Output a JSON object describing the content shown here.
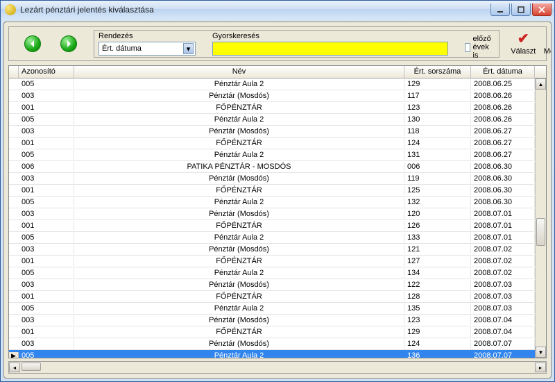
{
  "window": {
    "title": "Lezárt pénztári jelentés kiválasztása"
  },
  "toolbar": {
    "sort_label": "Rendezés",
    "sort_value": "Ért. dátuma",
    "search_label": "Gyorskeresés",
    "search_value": "",
    "prev_years_label": "előző évek is",
    "choose_label": "Választ",
    "cancel_label": "Mégse"
  },
  "columns": {
    "id": "Azonosító",
    "name": "Név",
    "sorszam": "Ért. sorszáma",
    "date": "Ért. dátuma"
  },
  "rows": [
    {
      "id": "005",
      "name": "Pénztár Aula 2",
      "sor": "129",
      "date": "2008.06.25"
    },
    {
      "id": "003",
      "name": "Pénztár (Mosdós)",
      "sor": "117",
      "date": "2008.06.26"
    },
    {
      "id": "001",
      "name": "FŐPÉNZTÁR",
      "sor": "123",
      "date": "2008.06.26"
    },
    {
      "id": "005",
      "name": "Pénztár Aula 2",
      "sor": "130",
      "date": "2008.06.26"
    },
    {
      "id": "003",
      "name": "Pénztár (Mosdós)",
      "sor": "118",
      "date": "2008.06.27"
    },
    {
      "id": "001",
      "name": "FŐPÉNZTÁR",
      "sor": "124",
      "date": "2008.06.27"
    },
    {
      "id": "005",
      "name": "Pénztár Aula 2",
      "sor": "131",
      "date": "2008.06.27"
    },
    {
      "id": "006",
      "name": "PATIKA PÉNZTÁR - MOSDÓS",
      "sor": "006",
      "date": "2008.06.30"
    },
    {
      "id": "003",
      "name": "Pénztár (Mosdós)",
      "sor": "119",
      "date": "2008.06.30"
    },
    {
      "id": "001",
      "name": "FŐPÉNZTÁR",
      "sor": "125",
      "date": "2008.06.30"
    },
    {
      "id": "005",
      "name": "Pénztár Aula 2",
      "sor": "132",
      "date": "2008.06.30"
    },
    {
      "id": "003",
      "name": "Pénztár (Mosdós)",
      "sor": "120",
      "date": "2008.07.01"
    },
    {
      "id": "001",
      "name": "FŐPÉNZTÁR",
      "sor": "126",
      "date": "2008.07.01"
    },
    {
      "id": "005",
      "name": "Pénztár Aula 2",
      "sor": "133",
      "date": "2008.07.01"
    },
    {
      "id": "003",
      "name": "Pénztár (Mosdós)",
      "sor": "121",
      "date": "2008.07.02"
    },
    {
      "id": "001",
      "name": "FŐPÉNZTÁR",
      "sor": "127",
      "date": "2008.07.02"
    },
    {
      "id": "005",
      "name": "Pénztár Aula 2",
      "sor": "134",
      "date": "2008.07.02"
    },
    {
      "id": "003",
      "name": "Pénztár (Mosdós)",
      "sor": "122",
      "date": "2008.07.03"
    },
    {
      "id": "001",
      "name": "FŐPÉNZTÁR",
      "sor": "128",
      "date": "2008.07.03"
    },
    {
      "id": "005",
      "name": "Pénztár Aula 2",
      "sor": "135",
      "date": "2008.07.03"
    },
    {
      "id": "003",
      "name": "Pénztár (Mosdós)",
      "sor": "123",
      "date": "2008.07.04"
    },
    {
      "id": "001",
      "name": "FŐPÉNZTÁR",
      "sor": "129",
      "date": "2008.07.04"
    },
    {
      "id": "003",
      "name": "Pénztár (Mosdós)",
      "sor": "124",
      "date": "2008.07.07"
    },
    {
      "id": "005",
      "name": "Pénztár Aula 2",
      "sor": "136",
      "date": "2008.07.07",
      "selected": true
    }
  ]
}
